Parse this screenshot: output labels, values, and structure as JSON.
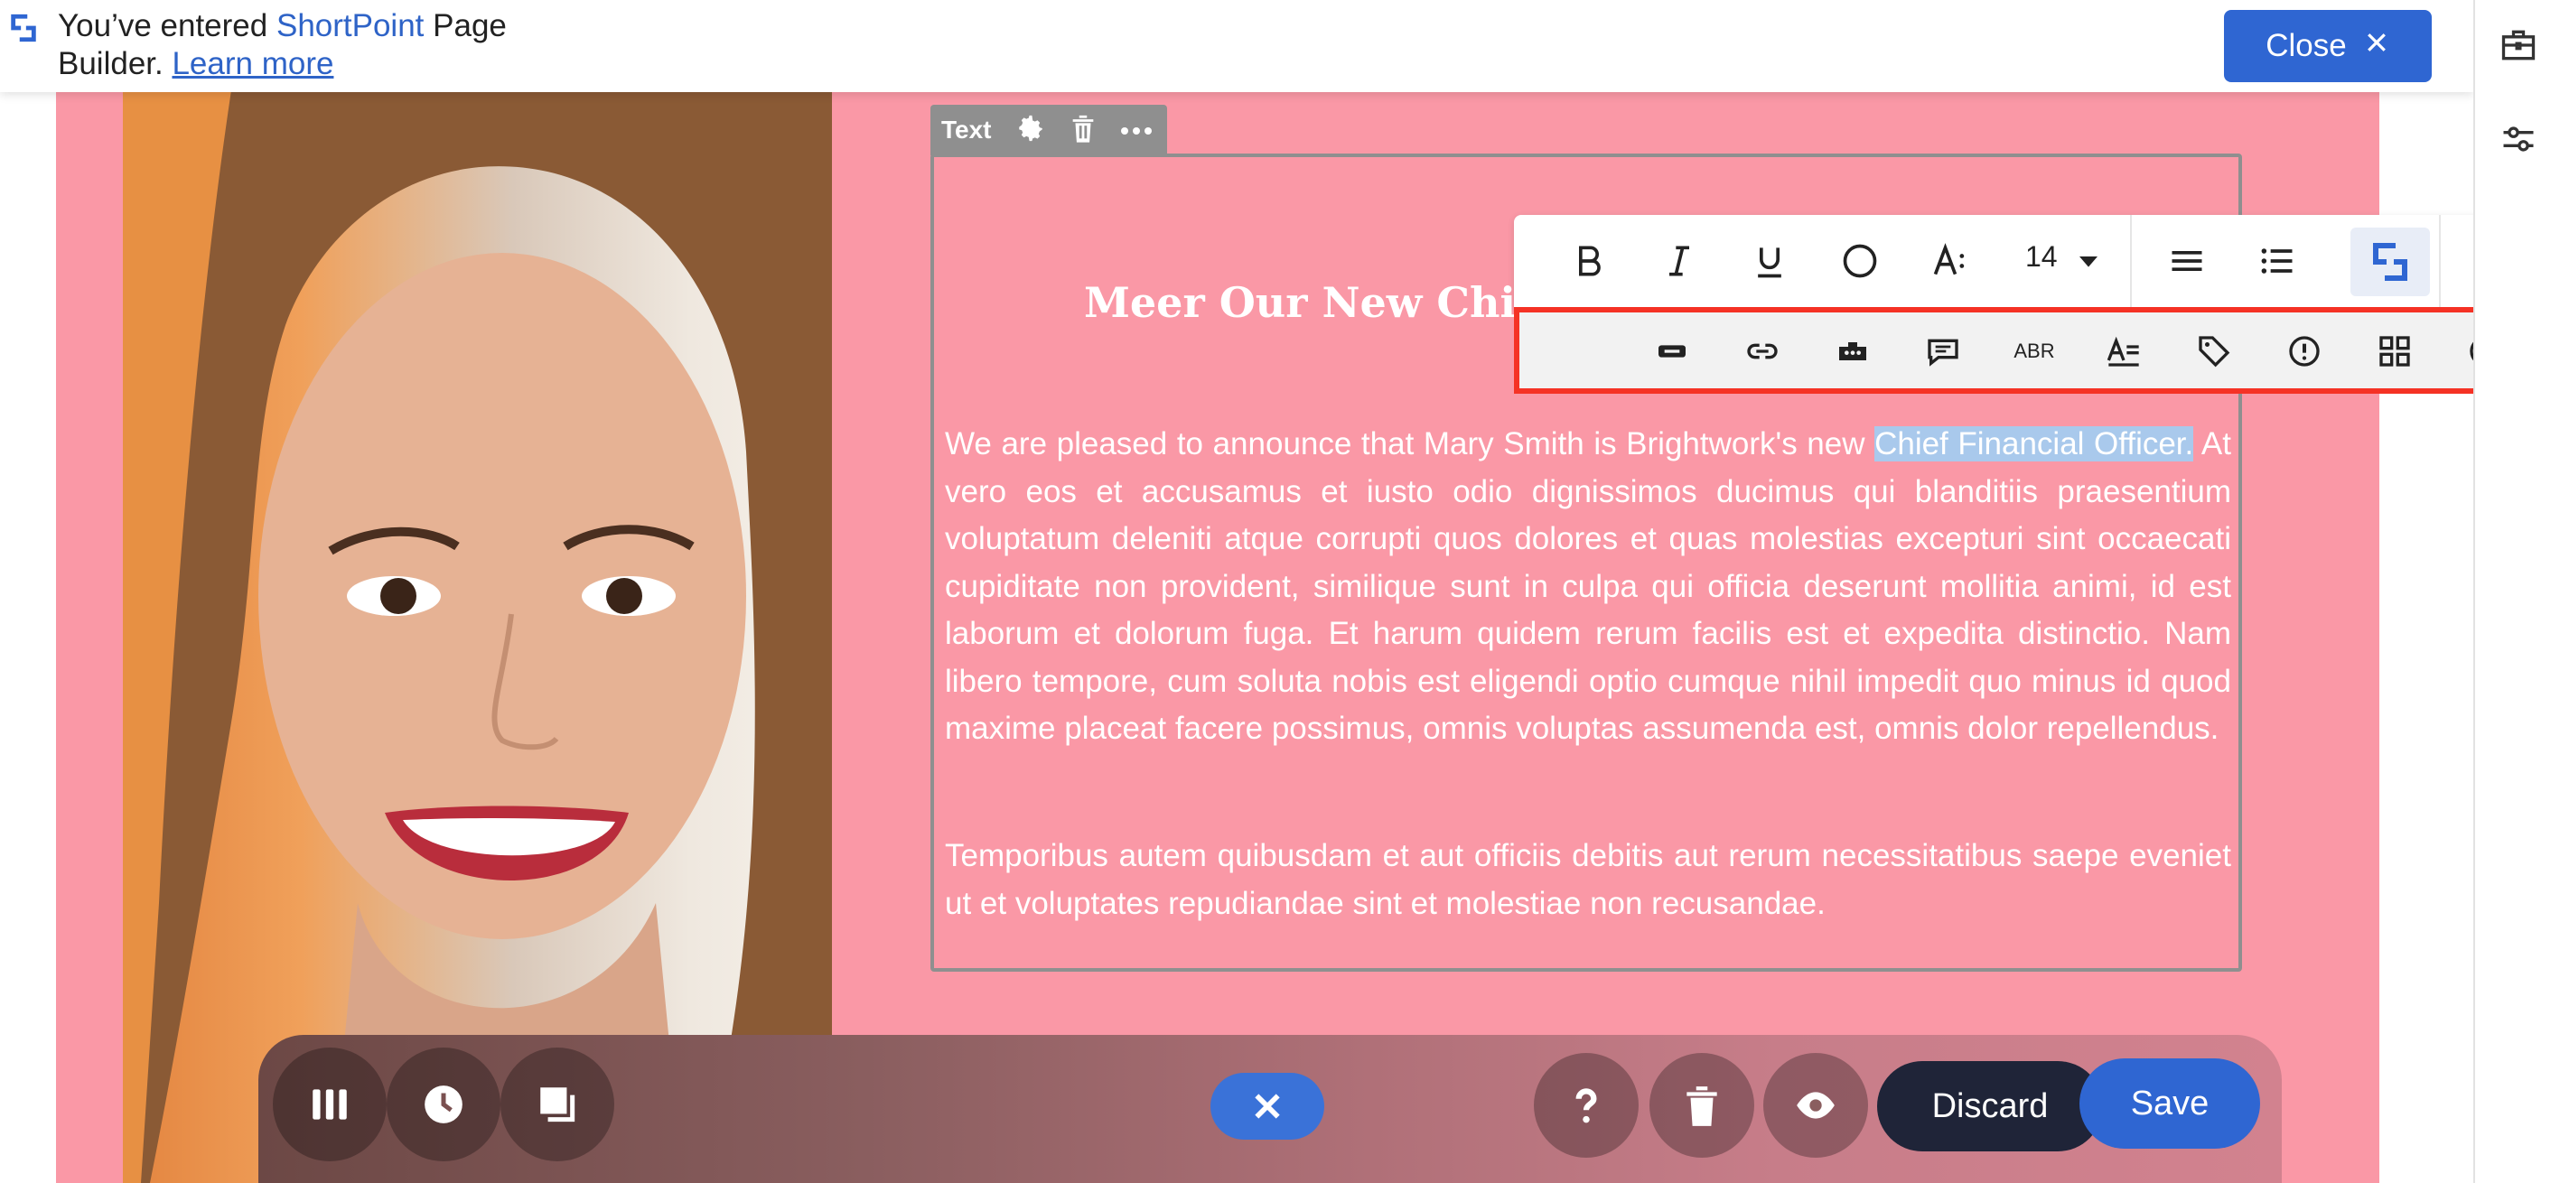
{
  "notification": {
    "prefix": "You’ve entered ",
    "brand": "ShortPoint",
    "middle": " Page",
    "line2": "Builder. ",
    "link": "Learn more",
    "close_label": "Close"
  },
  "text_element": {
    "tab_label": "Text",
    "heading": "Meer Our New Chief F",
    "paragraph1_before": "We are pleased to announce that Mary Smith is Brightwork's new ",
    "paragraph1_highlight": "Chief Financial Officer.",
    "paragraph1_after": " At vero eos et accusamus et iusto odio dignissimos ducimus qui blanditiis praesentium voluptatum deleniti atque corrupti quos dolores et quas molestias excepturi sint occaecati cupiditate non provident, similique sunt in culpa qui officia deserunt mollitia animi, id est laborum et dolorum fuga. Et harum quidem rerum facilis est et expedita distinctio. Nam libero tempore, cum soluta nobis est eligendi optio cumque nihil impedit quo minus id quod maxime placeat facere possimus, omnis voluptas assumenda est, omnis dolor repellendus.",
    "paragraph2": "Temporibus autem quibusdam et aut officiis debitis aut rerum necessitatibus saepe eveniet ut et voluptates repudiandae sint et molestiae non recusandae."
  },
  "rte_toolbar": {
    "font_size": "14",
    "row1_icons": [
      "bold-icon",
      "italic-icon",
      "underline-icon",
      "circle-icon",
      "font-style-icon",
      "font-size-dropdown",
      "align-icon",
      "list-icon",
      "shortpoint-icon",
      "chevron-down-icon"
    ],
    "row2_icons": [
      "highlight-icon",
      "link-icon",
      "embed-icon",
      "comment-icon",
      "abbreviation-icon",
      "text-format-icon",
      "tag-icon",
      "alert-icon",
      "grid-icon",
      "emoji-icon"
    ],
    "abbr_label": "ABR"
  },
  "dock": {
    "discard_label": "Discard",
    "save_label": "Save"
  },
  "colors": {
    "section_background": "#fa98a6",
    "brand_blue": "#2f66d2",
    "highlight": "#a9c9ec",
    "annotation_box": "#f53225"
  }
}
